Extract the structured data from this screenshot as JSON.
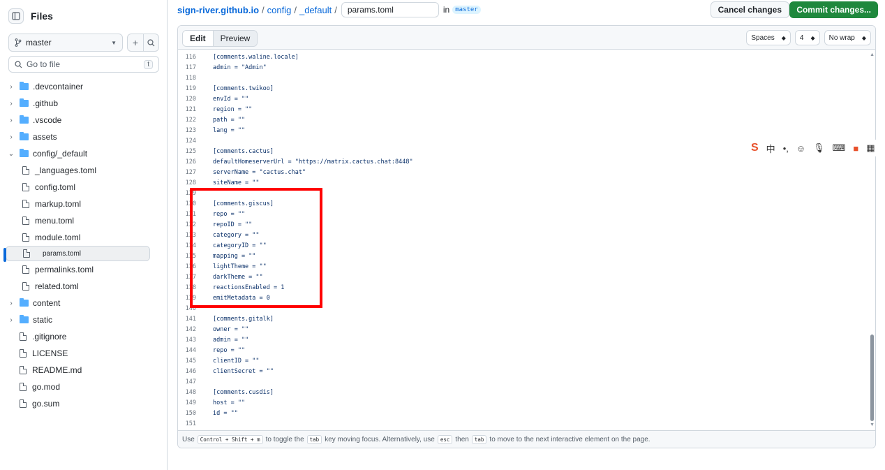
{
  "sidebar": {
    "title": "Files",
    "branch": "master",
    "search_placeholder": "Go to file",
    "search_shortcut": "t",
    "items": [
      {
        "label": ".devcontainer",
        "kind": "folder",
        "expanded": false
      },
      {
        "label": ".github",
        "kind": "folder",
        "expanded": false
      },
      {
        "label": ".vscode",
        "kind": "folder",
        "expanded": false
      },
      {
        "label": "assets",
        "kind": "folder",
        "expanded": false
      },
      {
        "label": "config/_default",
        "kind": "folder",
        "expanded": true
      },
      {
        "label": "_languages.toml",
        "kind": "file",
        "nested": true
      },
      {
        "label": "config.toml",
        "kind": "file",
        "nested": true
      },
      {
        "label": "markup.toml",
        "kind": "file",
        "nested": true
      },
      {
        "label": "menu.toml",
        "kind": "file",
        "nested": true
      },
      {
        "label": "module.toml",
        "kind": "file",
        "nested": true
      },
      {
        "label": "params.toml",
        "kind": "file",
        "nested": true,
        "selected": true
      },
      {
        "label": "permalinks.toml",
        "kind": "file",
        "nested": true
      },
      {
        "label": "related.toml",
        "kind": "file",
        "nested": true
      },
      {
        "label": "content",
        "kind": "folder",
        "expanded": false
      },
      {
        "label": "static",
        "kind": "folder",
        "expanded": false
      },
      {
        "label": ".gitignore",
        "kind": "file"
      },
      {
        "label": "LICENSE",
        "kind": "file"
      },
      {
        "label": "README.md",
        "kind": "file"
      },
      {
        "label": "go.mod",
        "kind": "file"
      },
      {
        "label": "go.sum",
        "kind": "file"
      }
    ]
  },
  "breadcrumb": {
    "repo": "sign-river.github.io",
    "sep": "/",
    "parts": [
      "config",
      "_default"
    ],
    "filename": "params.toml",
    "in_label": "in",
    "branch": "master"
  },
  "actions": {
    "cancel": "Cancel changes",
    "commit": "Commit changes..."
  },
  "editor": {
    "tab_edit": "Edit",
    "tab_preview": "Preview",
    "indent_mode": "Spaces",
    "indent_size": "4",
    "wrap_mode": "No wrap",
    "lines": [
      {
        "n": "116",
        "t": "[comments.waline.locale]"
      },
      {
        "n": "117",
        "t": "admin = \"Admin\""
      },
      {
        "n": "118",
        "t": ""
      },
      {
        "n": "119",
        "t": "[comments.twikoo]"
      },
      {
        "n": "120",
        "t": "envId = \"\""
      },
      {
        "n": "121",
        "t": "region = \"\""
      },
      {
        "n": "122",
        "t": "path = \"\""
      },
      {
        "n": "123",
        "t": "lang = \"\""
      },
      {
        "n": "124",
        "t": ""
      },
      {
        "n": "125",
        "t": "[comments.cactus]"
      },
      {
        "n": "126",
        "t": "defaultHomeserverUrl = \"https://matrix.cactus.chat:8448\""
      },
      {
        "n": "127",
        "t": "serverName = \"cactus.chat\""
      },
      {
        "n": "128",
        "t": "siteName = \"\""
      },
      {
        "n": "129",
        "t": ""
      },
      {
        "n": "130",
        "t": "[comments.giscus]"
      },
      {
        "n": "131",
        "t": "repo = \"\""
      },
      {
        "n": "132",
        "t": "repoID = \"\""
      },
      {
        "n": "133",
        "t": "category = \"\""
      },
      {
        "n": "134",
        "t": "categoryID = \"\""
      },
      {
        "n": "135",
        "t": "mapping = \"\""
      },
      {
        "n": "136",
        "t": "lightTheme = \"\""
      },
      {
        "n": "137",
        "t": "darkTheme = \"\""
      },
      {
        "n": "138",
        "t": "reactionsEnabled = 1"
      },
      {
        "n": "139",
        "t": "emitMetadata = 0"
      },
      {
        "n": "140",
        "t": ""
      },
      {
        "n": "141",
        "t": "[comments.gitalk]"
      },
      {
        "n": "142",
        "t": "owner = \"\""
      },
      {
        "n": "143",
        "t": "admin = \"\""
      },
      {
        "n": "144",
        "t": "repo = \"\""
      },
      {
        "n": "145",
        "t": "clientID = \"\""
      },
      {
        "n": "146",
        "t": "clientSecret = \"\""
      },
      {
        "n": "147",
        "t": ""
      },
      {
        "n": "148",
        "t": "[comments.cusdis]"
      },
      {
        "n": "149",
        "t": "host = \"\""
      },
      {
        "n": "150",
        "t": "id = \"\""
      },
      {
        "n": "151",
        "t": ""
      }
    ],
    "footer": {
      "use": "Use",
      "k_ctrl": "Control",
      "k_plus": "+",
      "k_shift": "Shift",
      "k_m": "m",
      "t1": "to toggle the",
      "k_tab": "tab",
      "t2": "key moving focus. Alternatively, use",
      "k_esc": "esc",
      "t3": "then",
      "t4": "to move to the next interactive element on the page."
    }
  },
  "ime_toolbar": {
    "logo": "S",
    "chinese": "中"
  }
}
